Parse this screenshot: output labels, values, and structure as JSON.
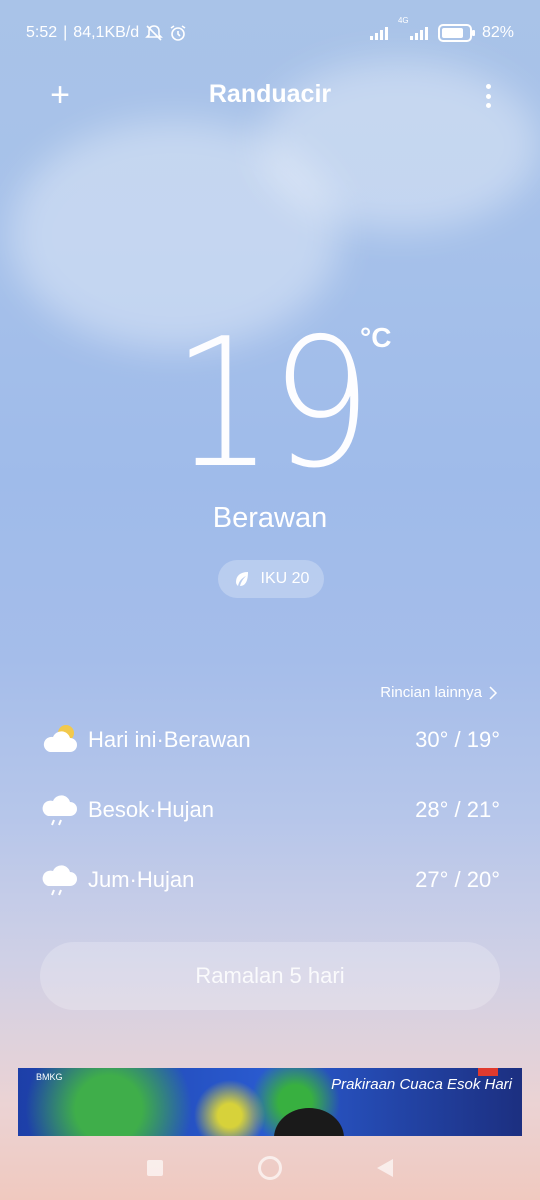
{
  "status_bar": {
    "time": "5:52",
    "net_speed": "84,1KB/d",
    "network_type": "4G",
    "battery_percent": "82%",
    "battery_level": 0.82,
    "icons": [
      "bell-off-icon",
      "alarm-icon",
      "signal-icon",
      "signal-icon",
      "battery-icon"
    ]
  },
  "header": {
    "add_symbol": "+",
    "city": "Randuacir",
    "menu_icon": "more-vertical-icon"
  },
  "current": {
    "temperature": "19",
    "unit": "°C",
    "condition": "Berawan",
    "aqi_label": "IKU 20",
    "aqi_icon": "leaf-icon"
  },
  "forecast": {
    "more_label": "Rincian lainnya",
    "days": [
      {
        "label": "Hari ini·Berawan",
        "range": "30° / 19°",
        "icon": "partly-cloudy-icon"
      },
      {
        "label": "Besok·Hujan",
        "range": "28° / 21°",
        "icon": "rain-icon"
      },
      {
        "label": "Jum·Hujan",
        "range": "27° / 20°",
        "icon": "rain-icon"
      }
    ],
    "button_label": "Ramalan 5 hari"
  },
  "banner": {
    "title": "Prakiraan Cuaca Esok Hari",
    "logo_text": "BMKG"
  },
  "nav_bar": {
    "icons": [
      "recents-icon",
      "home-icon",
      "back-icon"
    ]
  },
  "colors": {
    "sky_top": "#a9c3e8",
    "sky_bottom": "#f0c9bf",
    "text": "#ffffff"
  }
}
